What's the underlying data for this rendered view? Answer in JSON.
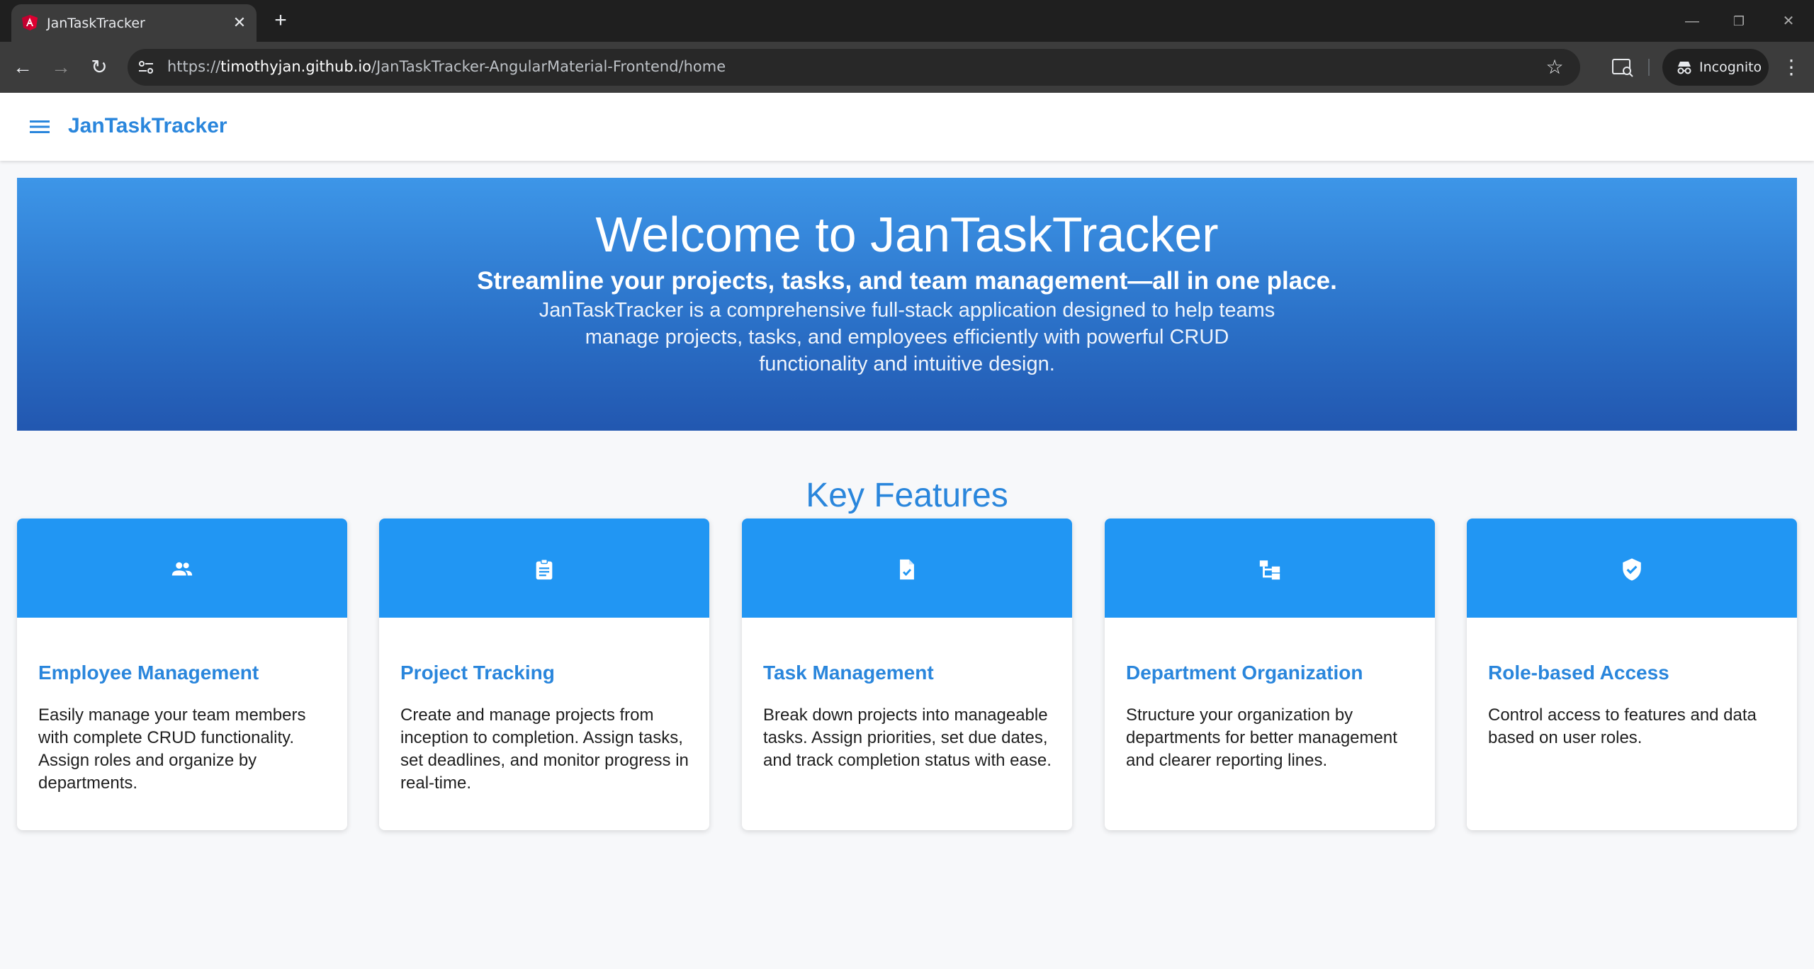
{
  "browser": {
    "tab_title": "JanTaskTracker",
    "url_scheme": "https://",
    "url_host": "timothyjan.github.io",
    "url_path": "/JanTaskTracker-AngularMaterial-Frontend/home",
    "incognito_label": "Incognito"
  },
  "header": {
    "app_title": "JanTaskTracker"
  },
  "hero": {
    "title": "Welcome to JanTaskTracker",
    "subtitle": "Streamline your projects, tasks, and team management—all in one place.",
    "description": "JanTaskTracker is a comprehensive full-stack application designed to help teams manage projects, tasks, and employees efficiently with powerful CRUD functionality and intuitive design."
  },
  "features": {
    "title": "Key Features",
    "cards": [
      {
        "icon": "people-icon",
        "title": "Employee Management",
        "description": "Easily manage your team members with complete CRUD functionality. Assign roles and organize by departments."
      },
      {
        "icon": "clipboard-icon",
        "title": "Project Tracking",
        "description": "Create and manage projects from inception to completion. Assign tasks, set deadlines, and monitor progress in real-time."
      },
      {
        "icon": "task-file-icon",
        "title": "Task Management",
        "description": "Break down projects into manageable tasks. Assign priorities, set due dates, and track completion status with ease."
      },
      {
        "icon": "hierarchy-icon",
        "title": "Department Organization",
        "description": "Structure your organization by departments for better management and clearer reporting lines."
      },
      {
        "icon": "shield-check-icon",
        "title": "Role-based Access",
        "description": "Control access to features and data based on user roles."
      }
    ]
  },
  "colors": {
    "accent": "#2a86dc",
    "card_header": "#2196f3",
    "hero_top": "#3d96e8",
    "hero_bottom": "#2257b0"
  }
}
